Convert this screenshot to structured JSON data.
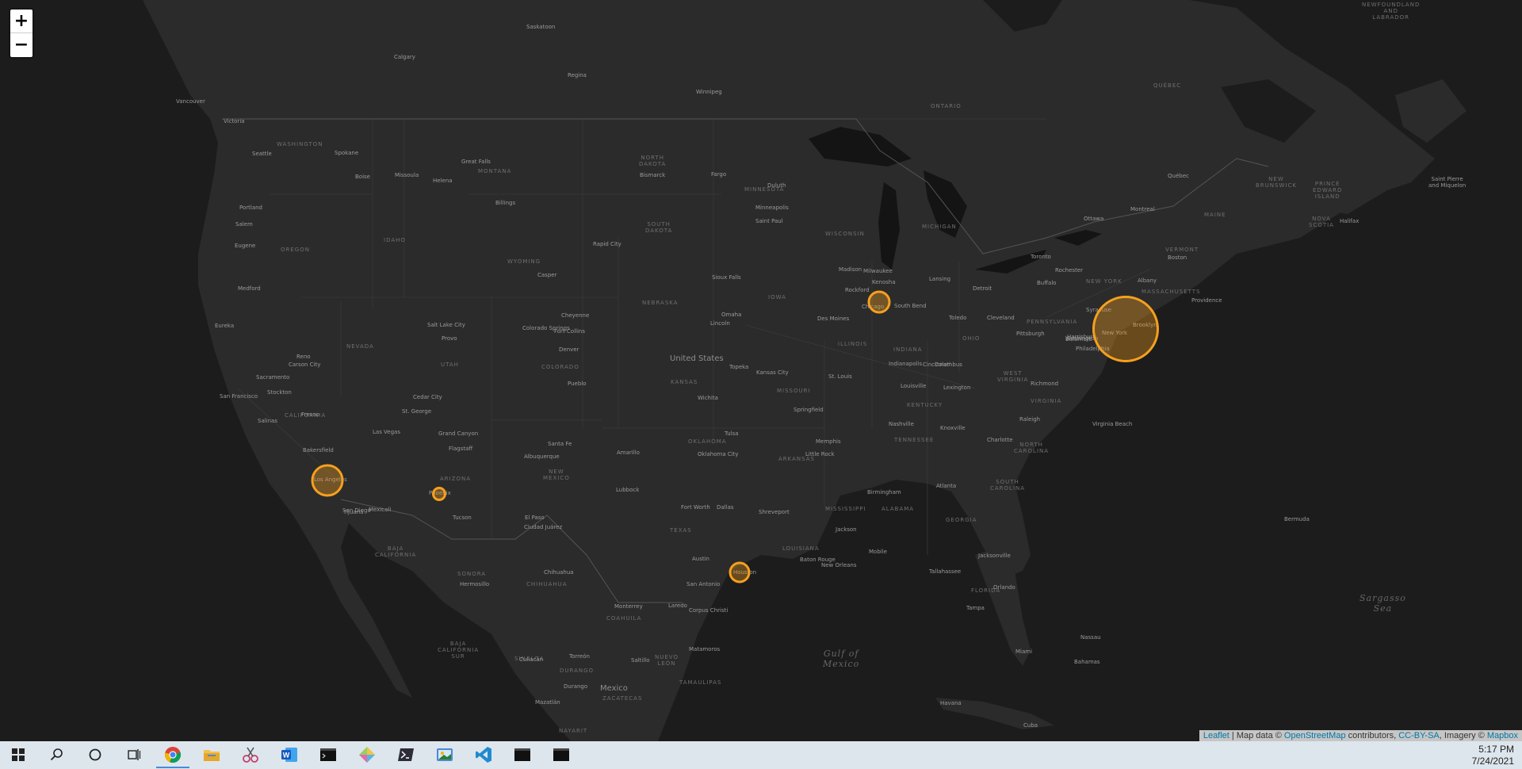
{
  "map": {
    "zoom_in_label": "+",
    "zoom_out_label": "−",
    "countries": [
      "United States",
      "Mexico"
    ],
    "seas": {
      "gulf": "Gulf of\nMexico",
      "sargasso": "Sargasso\nSea"
    },
    "states": [
      "WASHINGTON",
      "OREGON",
      "IDAHO",
      "MONTANA",
      "NORTH\nDAKOTA",
      "SOUTH\nDAKOTA",
      "MINNESOTA",
      "WISCONSIN",
      "MICHIGAN",
      "WYOMING",
      "NEBRASKA",
      "IOWA",
      "ILLINOIS",
      "INDIANA",
      "OHIO",
      "PENNSYLVANIA",
      "NEW YORK",
      "NEVADA",
      "UTAH",
      "COLORADO",
      "KANSAS",
      "MISSOURI",
      "KENTUCKY",
      "WEST\nVIRGINIA",
      "VIRGINIA",
      "CALIFORNIA",
      "ARIZONA",
      "NEW\nMEXICO",
      "OKLAHOMA",
      "ARKANSAS",
      "TENNESSEE",
      "NORTH\nCAROLINA",
      "SOUTH\nCAROLINA",
      "TEXAS",
      "LOUISIANA",
      "MISSISSIPPI",
      "ALABAMA",
      "GEORGIA",
      "FLORIDA",
      "ONTARIO",
      "QUÉBEC",
      "MAINE",
      "VERMONT",
      "SONORA",
      "CHIHUAHUA",
      "COAHUILA",
      "NUEVO\nLEÓN",
      "TAMAULIPAS",
      "BAJA\nCALIFORNIA",
      "BAJA\nCALIFORNIA\nSUR",
      "SINALOA",
      "DURANGO",
      "ZACATECAS",
      "NEWFOUNDLAND\nAND\nLABRADOR",
      "NEW\nBRUNSWICK",
      "PRINCE\nEDWARD\nISLAND",
      "NOVA\nSCOTIA",
      "MASSACHUSETTS",
      "NAYARIT"
    ],
    "cities": [
      "Seattle",
      "Portland",
      "Salem",
      "Eugene",
      "Medford",
      "Eureka",
      "Sacramento",
      "San Francisco",
      "Stockton",
      "Fresno",
      "Salinas",
      "Bakersfield",
      "Los Angeles",
      "San Diego",
      "Tijuana",
      "Mexicali",
      "Las Vegas",
      "Reno",
      "Carson City",
      "Boise",
      "Spokane",
      "Missoula",
      "Helena",
      "Billings",
      "Great Falls",
      "Salt Lake City",
      "Provo",
      "St. George",
      "Cedar City",
      "Phoenix",
      "Tucson",
      "Flagstaff",
      "Grand Canyon",
      "Albuquerque",
      "Santa Fe",
      "El Paso",
      "Ciudad Juárez",
      "Denver",
      "Colorado Springs",
      "Pueblo",
      "Fort Collins",
      "Cheyenne",
      "Casper",
      "Rapid City",
      "Bismarck",
      "Fargo",
      "Sioux Falls",
      "Omaha",
      "Lincoln",
      "Des Moines",
      "Minneapolis",
      "Saint Paul",
      "Duluth",
      "Madison",
      "Milwaukee",
      "Chicago",
      "Rockford",
      "Kenosha",
      "South Bend",
      "Detroit",
      "Lansing",
      "Toledo",
      "Cleveland",
      "Columbus",
      "Cincinnati",
      "Indianapolis",
      "Louisville",
      "Lexington",
      "St. Louis",
      "Kansas City",
      "Topeka",
      "Wichita",
      "Springfield",
      "Tulsa",
      "Oklahoma City",
      "Amarillo",
      "Lubbock",
      "Dallas",
      "Fort Worth",
      "Austin",
      "San Antonio",
      "Houston",
      "Corpus Christi",
      "Laredo",
      "Shreveport",
      "Little Rock",
      "Memphis",
      "Nashville",
      "Knoxville",
      "Atlanta",
      "Birmingham",
      "Jackson",
      "New Orleans",
      "Baton Rouge",
      "Mobile",
      "Tallahassee",
      "Jacksonville",
      "Orlando",
      "Tampa",
      "Miami",
      "Charlotte",
      "Raleigh",
      "Richmond",
      "Virginia Beach",
      "Washington",
      "Baltimore",
      "Philadelphia",
      "New York",
      "Brooklyn",
      "Boston",
      "Providence",
      "Albany",
      "Syracuse",
      "Buffalo",
      "Rochester",
      "Pittsburgh",
      "Harrisburg",
      "Toronto",
      "Ottawa",
      "Montreal",
      "Québec",
      "Halifax",
      "Calgary",
      "Regina",
      "Winnipeg",
      "Saskatoon",
      "Vancouver",
      "Victoria",
      "Havana",
      "Monterrey",
      "Chihuahua",
      "Hermosillo",
      "Culiacán",
      "Mazatlán",
      "Torreón",
      "Saltillo",
      "Durango",
      "Matamoros",
      "Bermuda",
      "Nassau",
      "Bahamas",
      "Cuba",
      "Saint Pierre\nand Miquelon"
    ],
    "bubbles": [
      {
        "name": "New York",
        "value": 1.0
      },
      {
        "name": "Los Angeles",
        "value": 0.35
      },
      {
        "name": "Chicago",
        "value": 0.12
      },
      {
        "name": "Houston",
        "value": 0.1
      },
      {
        "name": "Phoenix",
        "value": 0.05
      }
    ],
    "bubble_color": "#f5a01e",
    "attribution": {
      "leaflet": "Leaflet",
      "sep": " | Map data © ",
      "osm": "OpenStreetMap",
      "contrib": " contributors, ",
      "license": "CC-BY-SA",
      "imagery": ", Imagery © ",
      "mapbox": "Mapbox"
    }
  },
  "taskbar": {
    "icons": [
      "windows-start-icon",
      "search-icon",
      "cortana-icon",
      "task-view-icon",
      "chrome-icon",
      "file-explorer-icon",
      "snipping-tool-icon",
      "word-icon",
      "terminal-icon",
      "paint-icon",
      "powershell-icon",
      "pictures-app-icon",
      "vscode-icon",
      "terminal-icon",
      "terminal-icon"
    ],
    "time": "5:17 PM",
    "date": "7/24/2021"
  }
}
